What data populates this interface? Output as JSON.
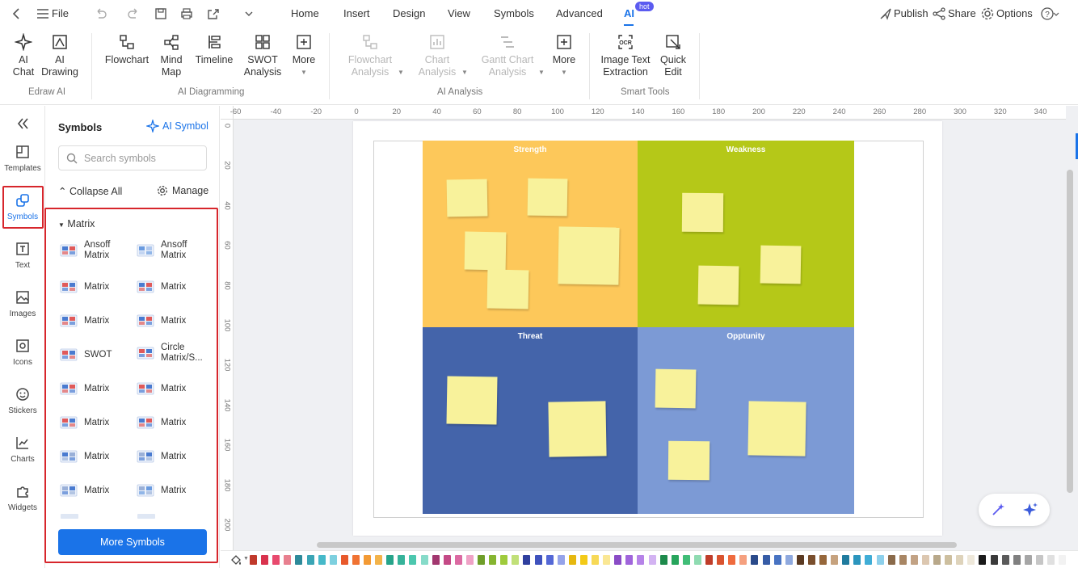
{
  "topbar": {
    "file_label": "File",
    "tabs": [
      "Home",
      "Insert",
      "Design",
      "View",
      "Symbols",
      "Advanced",
      "AI"
    ],
    "hot_badge": "hot",
    "publish": "Publish",
    "share": "Share",
    "options": "Options"
  },
  "ribbon": {
    "ai_chat": [
      "AI",
      "Chat"
    ],
    "ai_drawing": [
      "AI",
      "Drawing"
    ],
    "flowchart": "Flowchart",
    "mind_map": [
      "Mind",
      "Map"
    ],
    "timeline": "Timeline",
    "swot": [
      "SWOT",
      "Analysis"
    ],
    "more1": "More",
    "flowchart_analysis": [
      "Flowchart",
      "Analysis"
    ],
    "chart_analysis": [
      "Chart",
      "Analysis"
    ],
    "gantt_analysis": [
      "Gantt Chart",
      "Analysis"
    ],
    "more2": "More",
    "image_text": [
      "Image Text",
      "Extraction"
    ],
    "quick_edit": [
      "Quick",
      "Edit"
    ],
    "groups": [
      "Edraw AI",
      "AI Diagramming",
      "AI Analysis",
      "Smart Tools"
    ]
  },
  "leftbar": [
    "Templates",
    "Symbols",
    "Text",
    "Images",
    "Icons",
    "Stickers",
    "Charts",
    "Widgets"
  ],
  "panel": {
    "title": "Symbols",
    "ai_symbol": "AI Symbol",
    "search_placeholder": "Search symbols",
    "collapse_all": "Collapse All",
    "manage": "Manage",
    "section": "Matrix",
    "items": [
      [
        "Ansoff",
        "Matrix"
      ],
      [
        "Ansoff",
        "Matrix"
      ],
      [
        "Matrix"
      ],
      [
        "Matrix"
      ],
      [
        "Matrix"
      ],
      [
        "Matrix"
      ],
      [
        "SWOT"
      ],
      [
        "Circle",
        "Matrix/S..."
      ],
      [
        "Matrix"
      ],
      [
        "Matrix"
      ],
      [
        "Matrix"
      ],
      [
        "Matrix"
      ],
      [
        "Matrix"
      ],
      [
        "Matrix"
      ],
      [
        "Matrix"
      ],
      [
        "Matrix"
      ]
    ],
    "more_symbols": "More Symbols"
  },
  "ruler_x": [
    "-60",
    "-40",
    "-20",
    "0",
    "20",
    "40",
    "60",
    "80",
    "100",
    "120",
    "140",
    "160",
    "180",
    "200",
    "220",
    "240",
    "260",
    "280",
    "300",
    "320",
    "340"
  ],
  "ruler_y": [
    "0",
    "20",
    "40",
    "60",
    "80",
    "100",
    "120",
    "140",
    "160",
    "180",
    "200"
  ],
  "matrix": {
    "strength": "Strength",
    "weakness": "Weakness",
    "threat": "Threat",
    "opportunity": "Opptunity",
    "colors": {
      "strength": "#fdc85a",
      "weakness": "#b5c818",
      "threat": "#4464aa",
      "opportunity": "#7c9ad5"
    }
  },
  "palette": [
    "#c0392b",
    "#d9324d",
    "#e84a6e",
    "#e8808f",
    "#2e8a9a",
    "#3aa5b5",
    "#46b9c9",
    "#7dd0df",
    "#e8592b",
    "#f07333",
    "#f39a34",
    "#f3b34a",
    "#27a48a",
    "#36b39a",
    "#4cc7ae",
    "#86dbc9",
    "#a2376f",
    "#c44a86",
    "#db6aa2",
    "#efa2c6",
    "#6f9e2a",
    "#86b530",
    "#9fcb3c",
    "#c1e078",
    "#2f3f9e",
    "#3f52bd",
    "#5468d6",
    "#95a3ea",
    "#e6b80f",
    "#f3ca17",
    "#f7d956",
    "#fae794",
    "#8a4cc6",
    "#a065db",
    "#b683e8",
    "#d3b3f2",
    "#1d8a4b",
    "#27a55c",
    "#40bd77",
    "#8fdbb1",
    "#bf3d2a",
    "#d9532f",
    "#ef6b3e",
    "#f5a07f",
    "#2a4a8a",
    "#365ca6",
    "#4873c2",
    "#8fa9de",
    "#5b3a22",
    "#7a4f2d",
    "#96673b",
    "#c6a27e",
    "#1f7b9e",
    "#2b95bd",
    "#40add6",
    "#8dd0eb",
    "#8a6a4a",
    "#a88664",
    "#c2a284",
    "#dcc7b0",
    "#b8a88a",
    "#cdbf9f",
    "#ded3bb",
    "#eee8da",
    "#1a1a1a",
    "#3a3a3a",
    "#5a5a5a",
    "#808080",
    "#a6a6a6",
    "#c6c6c6",
    "#e0e0e0",
    "#f2f2f2"
  ]
}
